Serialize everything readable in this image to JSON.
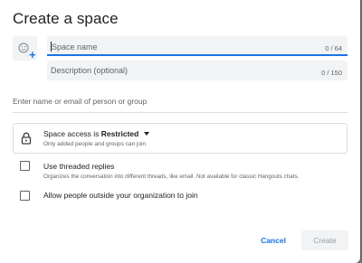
{
  "dialog": {
    "title": "Create a space",
    "emoji_button_icon": "add-emoji-icon",
    "space_name": {
      "placeholder": "Space name",
      "value": "",
      "counter": "0 / 64"
    },
    "description": {
      "placeholder": "Description (optional)",
      "value": "",
      "counter": "0 / 150"
    },
    "people": {
      "placeholder": "Enter name or email of person or group"
    },
    "access": {
      "prefix": "Space access is ",
      "value": "Restricted",
      "subtitle": "Only added people and groups can join",
      "icon": "lock-icon"
    },
    "options": [
      {
        "label": "Use threaded replies",
        "description": "Organizes the conversation into different threads, like email. Not available for classic Hangouts chats.",
        "checked": false
      },
      {
        "label": "Allow people outside your organization to join",
        "checked": false
      }
    ],
    "buttons": {
      "cancel": "Cancel",
      "create": "Create"
    },
    "colors": {
      "accent": "#1a73e8",
      "field_bg": "#f1f3f4",
      "disabled_text": "#9aa0a6"
    }
  }
}
